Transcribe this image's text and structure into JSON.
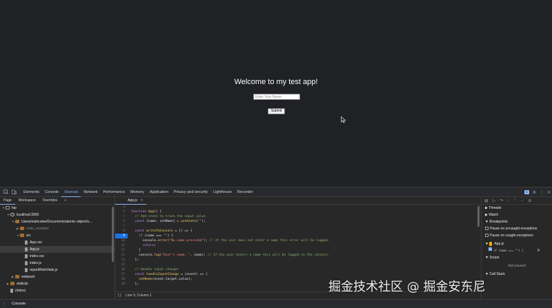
{
  "page": {
    "heading": "Welcome to my test app!",
    "input_placeholder": "Enter Your Name",
    "submit_label": "Submit"
  },
  "devtools": {
    "main_tabs": [
      "Elements",
      "Console",
      "Sources",
      "Network",
      "Performance",
      "Memory",
      "Application",
      "Privacy and security",
      "Lighthouse",
      "Recorder"
    ],
    "active_tab": "Sources",
    "issue_count": "1",
    "navigator_tabs": [
      "Page",
      "Workspace",
      "Overrides"
    ],
    "navigator_more": "»",
    "file_tree": [
      {
        "label": "top",
        "indent": 0,
        "icon": "top",
        "arrow": "▼"
      },
      {
        "label": "localhost:3000",
        "indent": 1,
        "icon": "cloud",
        "arrow": "▼"
      },
      {
        "label": "Users/mahculee/Documents/atomic-object/s...",
        "indent": 2,
        "icon": "folder",
        "arrow": "▼"
      },
      {
        "label": "node_modules",
        "indent": 3,
        "icon": "folder",
        "arrow": "▶",
        "dim": true
      },
      {
        "label": "src",
        "indent": 3,
        "icon": "folder",
        "arrow": "▼"
      },
      {
        "label": "App.css",
        "indent": 4,
        "icon": "file"
      },
      {
        "label": "App.js",
        "indent": 4,
        "icon": "file",
        "selected": true
      },
      {
        "label": "index.css",
        "indent": 4,
        "icon": "file"
      },
      {
        "label": "index.js",
        "indent": 4,
        "icon": "file"
      },
      {
        "label": "reportWebVitals.js",
        "indent": 4,
        "icon": "file"
      },
      {
        "label": "webpack",
        "indent": 2,
        "icon": "folder",
        "arrow": "▶"
      },
      {
        "label": "static/js",
        "indent": 1,
        "icon": "folder",
        "arrow": "▶"
      },
      {
        "label": "(index)",
        "indent": 1,
        "icon": "file"
      }
    ],
    "editor_tab": "App.js",
    "code_lines": [
      {
        "n": "3",
        "html": ""
      },
      {
        "n": "4",
        "html": "<span class=\"kw\">function</span> <span class=\"fn\">App</span>() {"
      },
      {
        "n": "5",
        "html": "  <span class=\"cm\">// Add state to track the input value</span>"
      },
      {
        "n": "6",
        "html": "  <span class=\"kw\">const</span> [name, setName] = <span class=\"fn\">useState</span>(<span class=\"str\">\"\"</span>);"
      },
      {
        "n": "7",
        "html": ""
      },
      {
        "n": "8",
        "html": "  <span class=\"kw\">const</span> <span class=\"fn\">writeToConsole</span> = () =&gt; {"
      },
      {
        "n": "9",
        "html": "    <span class=\"kw\">if</span> (name === <span class=\"str\">\"\"</span>) {",
        "bp": true
      },
      {
        "n": "10",
        "html": "      console.<span class=\"fn\">error</span>(<span class=\"str\">\"No name provided\"</span>); <span class=\"cm\">// If the user does not enter a name this error will be logged.</span>"
      },
      {
        "n": "11",
        "html": "      <span class=\"kw\">return</span>;"
      },
      {
        "n": "12",
        "html": "    }"
      },
      {
        "n": "13",
        "html": "    console.<span class=\"fn\">log</span>(<span class=\"str\">\"User's name: \"</span>, name); <span class=\"cm\">// If the user enters a name this will be logged to the console.</span>"
      },
      {
        "n": "14",
        "html": "  };"
      },
      {
        "n": "15",
        "html": ""
      },
      {
        "n": "16",
        "html": "  <span class=\"cm\">// Handle input changes</span>"
      },
      {
        "n": "17",
        "html": "  <span class=\"kw\">const</span> <span class=\"fn\">handleInputChange</span> = (event) =&gt; {"
      },
      {
        "n": "18",
        "html": "    <span class=\"fn\">setName</span>(event.target.value);"
      },
      {
        "n": "19",
        "html": "  };"
      }
    ],
    "status_text": "Line 9, Column 1",
    "status_brace": "{ }",
    "debugger": {
      "threads": "Threads",
      "watch": "Watch",
      "breakpoints": "Breakpoints",
      "pause_uncaught": "Pause on uncaught exceptions",
      "pause_caught": "Pause on caught exceptions",
      "bp_file": "App.js",
      "bp_code": "if (name === \"\") {",
      "bp_line": "9",
      "scope": "Scope",
      "not_paused": "Not paused",
      "call_stack": "Call Stack"
    },
    "drawer_tab": "Console"
  },
  "watermark": "掘金技术社区 @ 掘金安东尼"
}
